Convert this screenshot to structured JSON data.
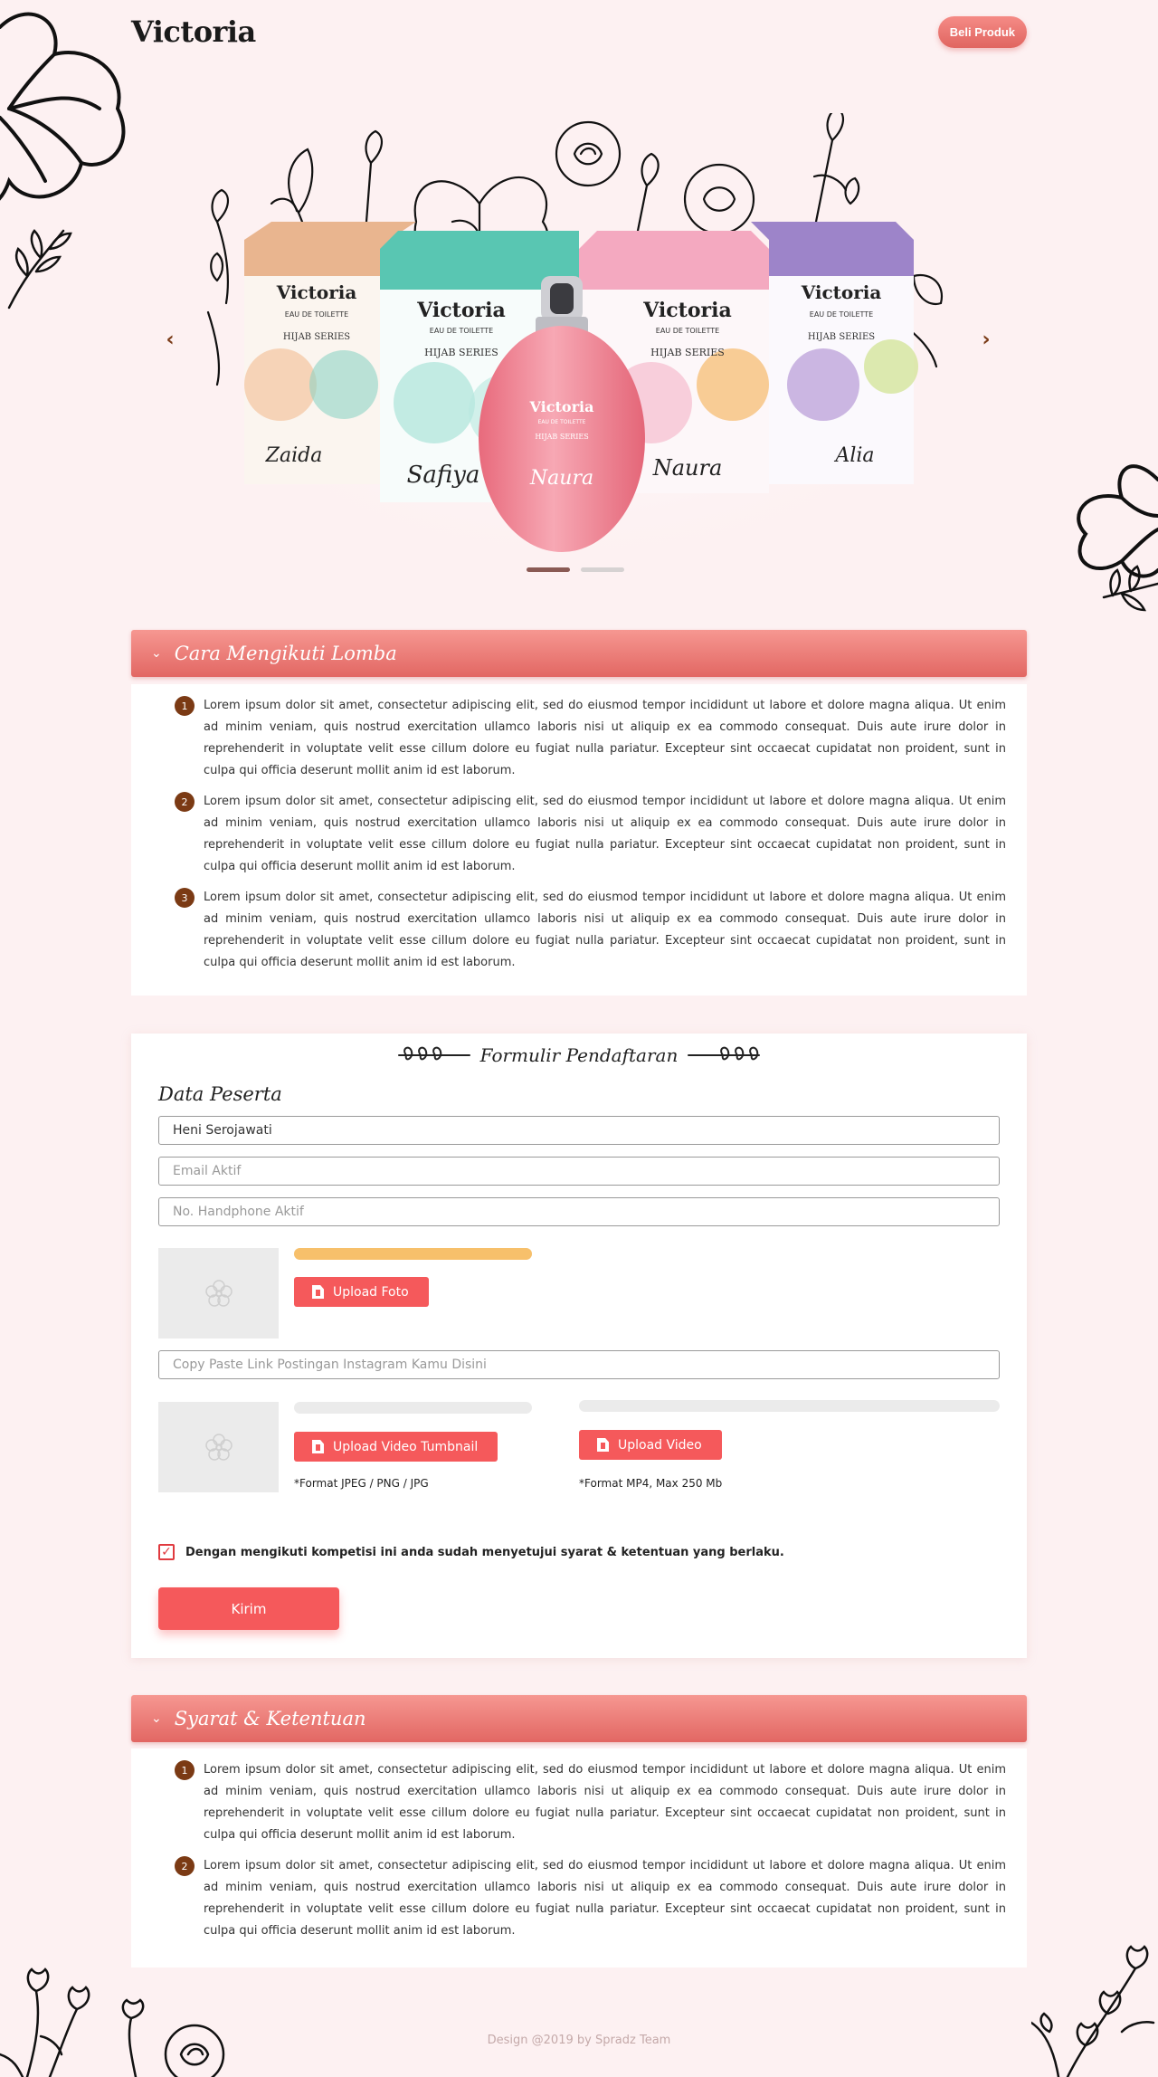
{
  "header": {
    "logo": "Victoria",
    "buy_button": "Beli Produk"
  },
  "hero": {
    "products": [
      {
        "brand": "Victoria",
        "line": "EAU DE TOILETTE",
        "series": "HIJAB SERIES",
        "name": "Zaida",
        "color": "#e9b58f"
      },
      {
        "brand": "Victoria",
        "line": "EAU DE TOILETTE",
        "series": "HIJAB SERIES",
        "name": "Safiya",
        "color": "#59c6b2"
      },
      {
        "brand": "Victoria",
        "line": "EAU DE TOILETTE",
        "series": "HIJAB SERIES",
        "name": "Naura",
        "color": "#f4a9c0"
      },
      {
        "brand": "Victoria",
        "line": "EAU DE TOILETTE",
        "series": "HIJAB SERIES",
        "name": "Alia",
        "color": "#9d84c9"
      }
    ],
    "bottle": {
      "brand": "Victoria",
      "line": "EAU DE TOILETTE",
      "series": "HIJAB SERIES",
      "name": "Naura"
    },
    "prev_icon": "chevron-left-icon",
    "next_icon": "chevron-right-icon",
    "slides_total": 2,
    "slide_active": 1
  },
  "rules_section": {
    "title": "Cara Mengikuti Lomba",
    "items": [
      {
        "num": "1",
        "text": "Lorem ipsum dolor sit amet, consectetur adipiscing elit, sed do eiusmod tempor incididunt ut labore et dolore magna aliqua. Ut enim ad minim veniam, quis nostrud exercitation ullamco laboris nisi ut aliquip ex ea commodo consequat. Duis aute irure dolor in reprehenderit in voluptate velit esse cillum dolore eu fugiat nulla pariatur. Excepteur sint occaecat cupidatat non proident, sunt in culpa qui officia deserunt mollit anim id est laborum."
      },
      {
        "num": "2",
        "text": "Lorem ipsum dolor sit amet, consectetur adipiscing elit, sed do eiusmod tempor incididunt ut labore et dolore magna aliqua. Ut enim ad minim veniam, quis nostrud exercitation ullamco laboris nisi ut aliquip ex ea commodo consequat. Duis aute irure dolor in reprehenderit in voluptate velit esse cillum dolore eu fugiat nulla pariatur. Excepteur sint occaecat cupidatat non proident, sunt in culpa qui officia deserunt mollit anim id est laborum."
      },
      {
        "num": "3",
        "text": "Lorem ipsum dolor sit amet, consectetur adipiscing elit, sed do eiusmod tempor incididunt ut labore et dolore magna aliqua. Ut enim ad minim veniam, quis nostrud exercitation ullamco laboris nisi ut aliquip ex ea commodo consequat. Duis aute irure dolor in reprehenderit in voluptate velit esse cillum dolore eu fugiat nulla pariatur. Excepteur sint occaecat cupidatat non proident, sunt in culpa qui officia deserunt mollit anim id est laborum."
      }
    ]
  },
  "form": {
    "title": "Formulir Pendaftaran",
    "section_title": "Data Peserta",
    "name_value": "Heni Serojawati",
    "email_placeholder": "Email Aktif",
    "phone_placeholder": "No. Handphone Aktif",
    "photo_upload_label": "Upload Foto",
    "photo_progress": 1.0,
    "instagram_placeholder": "Copy Paste Link Postingan Instagram Kamu Disini",
    "thumbnail_upload_label": "Upload Video Tumbnail",
    "thumbnail_progress": 0,
    "thumbnail_hint": "*Format JPEG / PNG / JPG",
    "video_upload_label": "Upload Video",
    "video_progress": 0,
    "video_hint": "*Format MP4, Max 250 Mb",
    "agree_checked": true,
    "agree_text": "Dengan mengikuti kompetisi ini anda sudah menyetujui syarat & ketentuan yang berlaku.",
    "submit_label": "Kirim"
  },
  "terms_section": {
    "title": "Syarat & Ketentuan",
    "items": [
      {
        "num": "1",
        "text": "Lorem ipsum dolor sit amet, consectetur adipiscing elit, sed do eiusmod tempor incididunt ut labore et dolore magna aliqua. Ut enim ad minim veniam, quis nostrud exercitation ullamco laboris nisi ut aliquip ex ea commodo consequat. Duis aute irure dolor in reprehenderit in voluptate velit esse cillum dolore eu fugiat nulla pariatur. Excepteur sint occaecat cupidatat non proident, sunt in culpa qui officia deserunt mollit anim id est laborum."
      },
      {
        "num": "2",
        "text": "Lorem ipsum dolor sit amet, consectetur adipiscing elit, sed do eiusmod tempor incididunt ut labore et dolore magna aliqua. Ut enim ad minim veniam, quis nostrud exercitation ullamco laboris nisi ut aliquip ex ea commodo consequat. Duis aute irure dolor in reprehenderit in voluptate velit esse cillum dolore eu fugiat nulla pariatur. Excepteur sint occaecat cupidatat non proident, sunt in culpa qui officia deserunt mollit anim id est laborum."
      }
    ]
  },
  "footer": {
    "text": "Design @2019 by Spradz Team"
  },
  "colors": {
    "background": "#fdf1f2",
    "accent": "#f5595b",
    "header_gradient_top": "#f69791",
    "header_gradient_bottom": "#e26763",
    "step_badge": "#7b3a14",
    "progress_fill": "#f7c06b"
  }
}
